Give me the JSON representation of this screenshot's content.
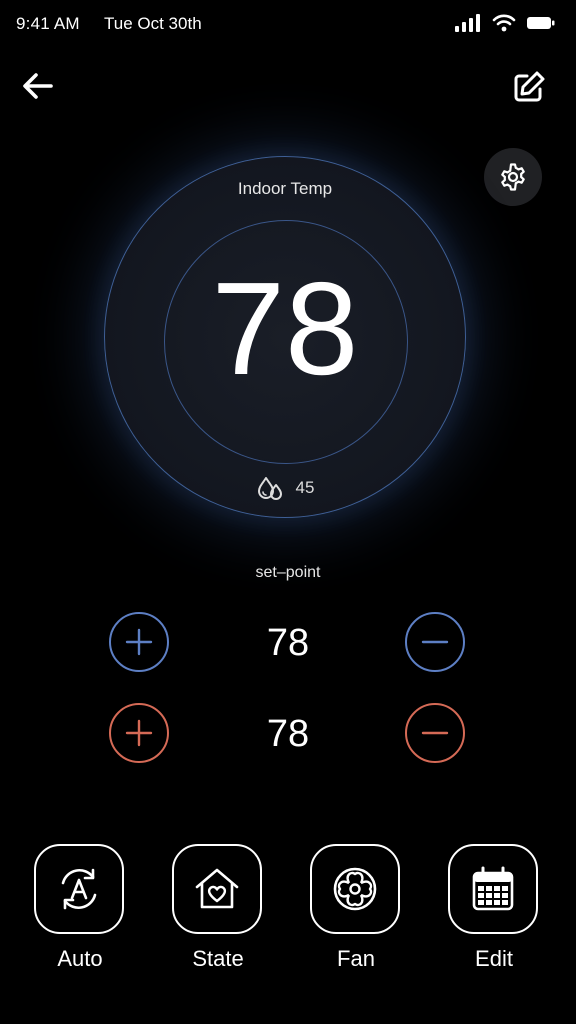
{
  "status_bar": {
    "time": "9:41 AM",
    "date": "Tue Oct 30th",
    "icons": [
      "cellular-signal-icon",
      "wifi-icon",
      "battery-icon"
    ]
  },
  "header": {
    "back_icon": "arrow-left-icon",
    "edit_icon": "edit-square-icon",
    "settings_icon": "gear-icon"
  },
  "dial": {
    "label": "Indoor Temp",
    "temperature": "78",
    "humidity": "45",
    "humidity_icon": "droplets-icon"
  },
  "setpoint": {
    "label": "set–point",
    "cool_value": "78",
    "heat_value": "78",
    "cool_color": "#5d7fc4",
    "heat_color": "#d56a56"
  },
  "modes": [
    {
      "label": "Auto",
      "icon": "auto-cycle-icon"
    },
    {
      "label": "State",
      "icon": "home-heart-icon"
    },
    {
      "label": "Fan",
      "icon": "fan-icon"
    },
    {
      "label": "Edit",
      "icon": "calendar-icon"
    }
  ]
}
